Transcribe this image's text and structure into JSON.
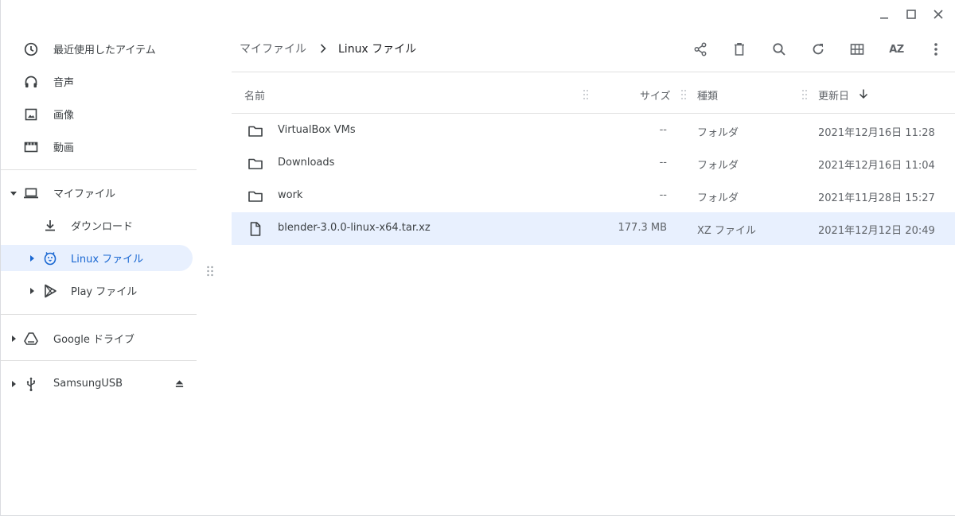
{
  "window_controls": {
    "minimize": "minimize",
    "maximize": "maximize",
    "close": "close"
  },
  "sidebar": {
    "items": [
      {
        "label": "最近使用したアイテム",
        "icon": "clock-icon"
      },
      {
        "label": "音声",
        "icon": "headphones-icon"
      },
      {
        "label": "画像",
        "icon": "image-icon"
      },
      {
        "label": "動画",
        "icon": "video-icon"
      },
      {
        "label": "マイファイル",
        "icon": "laptop-icon"
      },
      {
        "label": "ダウンロード",
        "icon": "download-icon"
      },
      {
        "label": "Linux ファイル",
        "icon": "penguin-icon"
      },
      {
        "label": "Play ファイル",
        "icon": "play-store-icon"
      },
      {
        "label": "Google ドライブ",
        "icon": "drive-icon"
      },
      {
        "label": "SamsungUSB",
        "icon": "usb-icon"
      }
    ],
    "active_index": 6
  },
  "breadcrumb": [
    "マイファイル",
    "Linux ファイル"
  ],
  "toolbar": {
    "buttons": [
      "share-icon",
      "delete-icon",
      "search-icon",
      "refresh-icon",
      "grid-view-icon",
      "sort-az-icon",
      "more-vert-icon"
    ],
    "sort_label": "AZ"
  },
  "table": {
    "headers": {
      "name": "名前",
      "size": "サイズ",
      "type": "種類",
      "date": "更新日"
    },
    "rows": [
      {
        "name": "VirtualBox VMs",
        "size": "--",
        "type": "フォルダ",
        "date": "2021年12月16日 11:28",
        "kind": "folder"
      },
      {
        "name": "Downloads",
        "size": "--",
        "type": "フォルダ",
        "date": "2021年12月16日 11:04",
        "kind": "folder"
      },
      {
        "name": "work",
        "size": "--",
        "type": "フォルダ",
        "date": "2021年11月28日 15:27",
        "kind": "folder"
      },
      {
        "name": "blender-3.0.0-linux-x64.tar.xz",
        "size": "177.3 MB",
        "type": "XZ ファイル",
        "date": "2021年12月12日 20:49",
        "kind": "file",
        "selected": true
      }
    ]
  },
  "colors": {
    "accent": "#1967d2",
    "selection": "#e8f0fe",
    "icon": "#5f6368"
  }
}
